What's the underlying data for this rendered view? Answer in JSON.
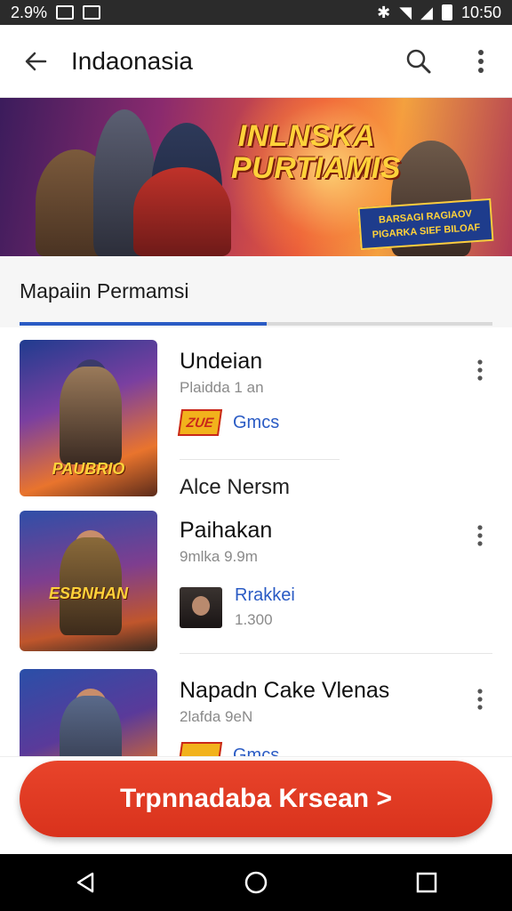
{
  "status_bar": {
    "left_text": "2.9%",
    "time": "10:50"
  },
  "app_bar": {
    "title": "Indaonasia"
  },
  "banner": {
    "headline": "INLNSKA PURTIAMIS",
    "tag": "BARSAGI RAGIAOV PIGARKA SIEF BILOAF"
  },
  "section": {
    "label": "Mapaiin Permamsi"
  },
  "items": [
    {
      "title": "Undeian",
      "subtitle": "Plaidda 1 an",
      "badge": "ZUE",
      "link": "Gmcs",
      "thumb_caption": "PAUBRIO"
    },
    {
      "section_label": "Alce Nersm"
    },
    {
      "title": "Paihakan",
      "subtitle": "9mlka 9.9m",
      "link": "Rrakkei",
      "count": "1.300",
      "thumb_caption": "ESBNHAN"
    },
    {
      "title": "Napadn Cake Vlenas",
      "subtitle": "2lafda 9eN",
      "link": "Gmcs"
    }
  ],
  "cta": {
    "label": "Trpnnadaba Krsean >"
  },
  "colors": {
    "accent": "#2a5bc4",
    "cta": "#e0391f",
    "badge": "#f2b21c"
  },
  "icons": [
    "back-arrow-icon",
    "search-icon",
    "more-vert-icon",
    "nav-back-icon",
    "nav-home-icon",
    "nav-recents-icon"
  ]
}
